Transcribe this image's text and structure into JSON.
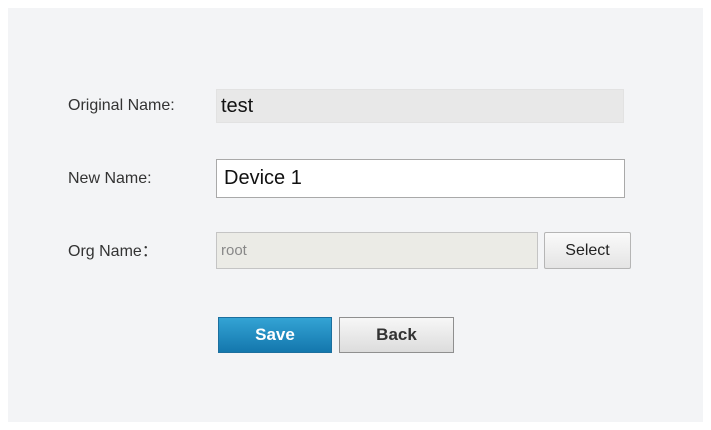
{
  "form": {
    "original_name": {
      "label": "Original Name:",
      "value": "test"
    },
    "new_name": {
      "label": "New Name:",
      "value": "Device 1"
    },
    "org_name": {
      "label": "Org Name：",
      "value": "root",
      "select_label": "Select"
    }
  },
  "actions": {
    "save_label": "Save",
    "back_label": "Back"
  },
  "colors": {
    "panel_background": "#f3f4f6",
    "primary_button": "#1f8bc3",
    "readonly_field": "#e8e8e8"
  }
}
